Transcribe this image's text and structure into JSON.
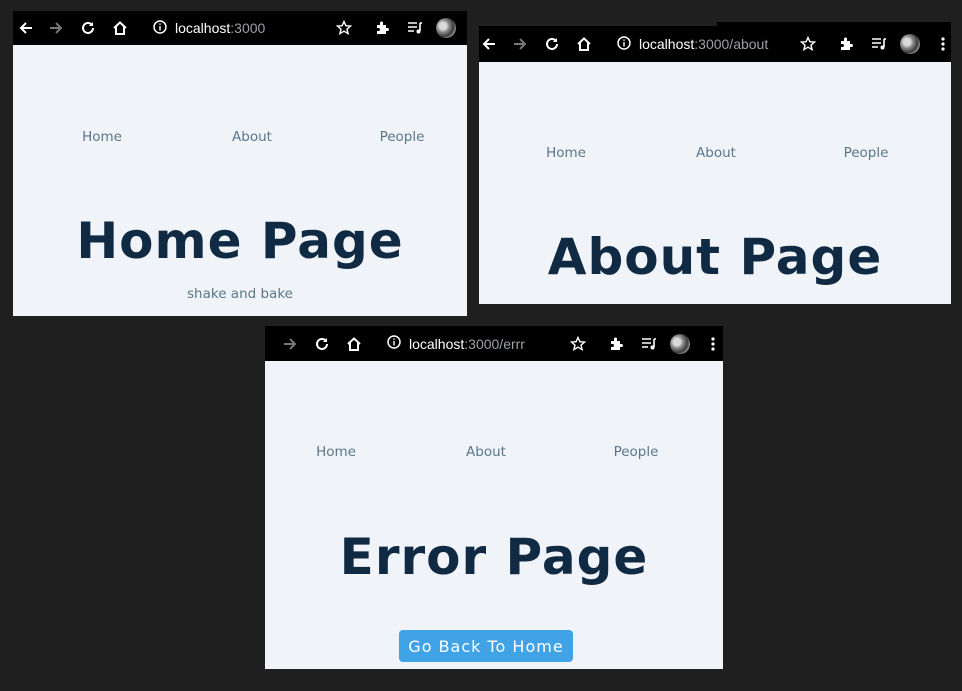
{
  "windows": {
    "home": {
      "url_host": "localhost",
      "url_rest": ":3000",
      "nav": [
        "Home",
        "About",
        "People"
      ],
      "heading": "Home Page",
      "subtitle": "shake and bake"
    },
    "about": {
      "url_host": "localhost",
      "url_rest": ":3000/about",
      "nav": [
        "Home",
        "About",
        "People"
      ],
      "heading": "About Page"
    },
    "error": {
      "url_host": "localhost",
      "url_rest": ":3000/errr",
      "nav": [
        "Home",
        "About",
        "People"
      ],
      "heading": "Error Page",
      "button": "Go Back To Home"
    }
  },
  "icons": [
    "back-icon",
    "forward-icon",
    "reload-icon",
    "home-icon",
    "info-icon",
    "star-icon",
    "extensions-icon",
    "media-queue-icon",
    "profile-avatar",
    "menu-icon"
  ],
  "colors": {
    "accent": "#3fa3e6",
    "heading": "#102a43",
    "nav": "#5a7689",
    "page_bg": "#f0f4f8"
  }
}
